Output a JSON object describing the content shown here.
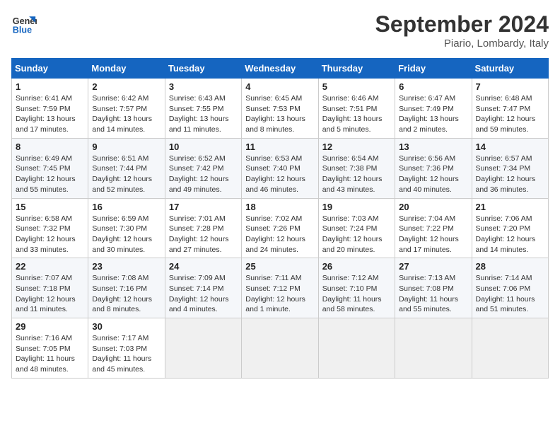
{
  "header": {
    "logo_line1": "General",
    "logo_line2": "Blue",
    "month": "September 2024",
    "location": "Piario, Lombardy, Italy"
  },
  "weekdays": [
    "Sunday",
    "Monday",
    "Tuesday",
    "Wednesday",
    "Thursday",
    "Friday",
    "Saturday"
  ],
  "weeks": [
    [
      {
        "day": "1",
        "sunrise": "6:41 AM",
        "sunset": "7:59 PM",
        "daylight": "13 hours and 17 minutes."
      },
      {
        "day": "2",
        "sunrise": "6:42 AM",
        "sunset": "7:57 PM",
        "daylight": "13 hours and 14 minutes."
      },
      {
        "day": "3",
        "sunrise": "6:43 AM",
        "sunset": "7:55 PM",
        "daylight": "13 hours and 11 minutes."
      },
      {
        "day": "4",
        "sunrise": "6:45 AM",
        "sunset": "7:53 PM",
        "daylight": "13 hours and 8 minutes."
      },
      {
        "day": "5",
        "sunrise": "6:46 AM",
        "sunset": "7:51 PM",
        "daylight": "13 hours and 5 minutes."
      },
      {
        "day": "6",
        "sunrise": "6:47 AM",
        "sunset": "7:49 PM",
        "daylight": "13 hours and 2 minutes."
      },
      {
        "day": "7",
        "sunrise": "6:48 AM",
        "sunset": "7:47 PM",
        "daylight": "12 hours and 59 minutes."
      }
    ],
    [
      {
        "day": "8",
        "sunrise": "6:49 AM",
        "sunset": "7:45 PM",
        "daylight": "12 hours and 55 minutes."
      },
      {
        "day": "9",
        "sunrise": "6:51 AM",
        "sunset": "7:44 PM",
        "daylight": "12 hours and 52 minutes."
      },
      {
        "day": "10",
        "sunrise": "6:52 AM",
        "sunset": "7:42 PM",
        "daylight": "12 hours and 49 minutes."
      },
      {
        "day": "11",
        "sunrise": "6:53 AM",
        "sunset": "7:40 PM",
        "daylight": "12 hours and 46 minutes."
      },
      {
        "day": "12",
        "sunrise": "6:54 AM",
        "sunset": "7:38 PM",
        "daylight": "12 hours and 43 minutes."
      },
      {
        "day": "13",
        "sunrise": "6:56 AM",
        "sunset": "7:36 PM",
        "daylight": "12 hours and 40 minutes."
      },
      {
        "day": "14",
        "sunrise": "6:57 AM",
        "sunset": "7:34 PM",
        "daylight": "12 hours and 36 minutes."
      }
    ],
    [
      {
        "day": "15",
        "sunrise": "6:58 AM",
        "sunset": "7:32 PM",
        "daylight": "12 hours and 33 minutes."
      },
      {
        "day": "16",
        "sunrise": "6:59 AM",
        "sunset": "7:30 PM",
        "daylight": "12 hours and 30 minutes."
      },
      {
        "day": "17",
        "sunrise": "7:01 AM",
        "sunset": "7:28 PM",
        "daylight": "12 hours and 27 minutes."
      },
      {
        "day": "18",
        "sunrise": "7:02 AM",
        "sunset": "7:26 PM",
        "daylight": "12 hours and 24 minutes."
      },
      {
        "day": "19",
        "sunrise": "7:03 AM",
        "sunset": "7:24 PM",
        "daylight": "12 hours and 20 minutes."
      },
      {
        "day": "20",
        "sunrise": "7:04 AM",
        "sunset": "7:22 PM",
        "daylight": "12 hours and 17 minutes."
      },
      {
        "day": "21",
        "sunrise": "7:06 AM",
        "sunset": "7:20 PM",
        "daylight": "12 hours and 14 minutes."
      }
    ],
    [
      {
        "day": "22",
        "sunrise": "7:07 AM",
        "sunset": "7:18 PM",
        "daylight": "12 hours and 11 minutes."
      },
      {
        "day": "23",
        "sunrise": "7:08 AM",
        "sunset": "7:16 PM",
        "daylight": "12 hours and 8 minutes."
      },
      {
        "day": "24",
        "sunrise": "7:09 AM",
        "sunset": "7:14 PM",
        "daylight": "12 hours and 4 minutes."
      },
      {
        "day": "25",
        "sunrise": "7:11 AM",
        "sunset": "7:12 PM",
        "daylight": "12 hours and 1 minute."
      },
      {
        "day": "26",
        "sunrise": "7:12 AM",
        "sunset": "7:10 PM",
        "daylight": "11 hours and 58 minutes."
      },
      {
        "day": "27",
        "sunrise": "7:13 AM",
        "sunset": "7:08 PM",
        "daylight": "11 hours and 55 minutes."
      },
      {
        "day": "28",
        "sunrise": "7:14 AM",
        "sunset": "7:06 PM",
        "daylight": "11 hours and 51 minutes."
      }
    ],
    [
      {
        "day": "29",
        "sunrise": "7:16 AM",
        "sunset": "7:05 PM",
        "daylight": "11 hours and 48 minutes."
      },
      {
        "day": "30",
        "sunrise": "7:17 AM",
        "sunset": "7:03 PM",
        "daylight": "11 hours and 45 minutes."
      },
      null,
      null,
      null,
      null,
      null
    ]
  ],
  "labels": {
    "sunrise": "Sunrise: ",
    "sunset": "Sunset: ",
    "daylight": "Daylight: "
  }
}
